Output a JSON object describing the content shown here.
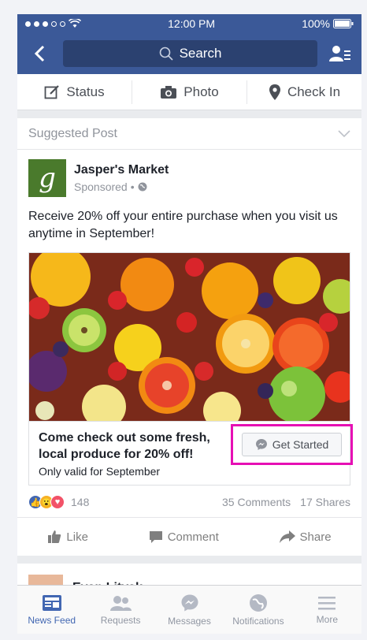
{
  "status_bar": {
    "time": "12:00 PM",
    "battery": "100%"
  },
  "nav": {
    "search_label": "Search"
  },
  "composer": [
    {
      "label": "Status",
      "icon": "edit-icon"
    },
    {
      "label": "Photo",
      "icon": "camera-icon"
    },
    {
      "label": "Check In",
      "icon": "location-pin-icon"
    }
  ],
  "post": {
    "header_label": "Suggested Post",
    "page_name": "Jasper's Market",
    "logo_letter": "g",
    "sponsored": "Sponsored",
    "message": "Receive 20% off your entire purchase when you visit us anytime in September!",
    "cta_headline": "Come check out some fresh, local produce for 20% off!",
    "cta_sub": "Only valid for September",
    "cta_button": "Get Started",
    "reaction_count": "148",
    "comments": "35 Comments",
    "shares": "17 Shares",
    "actions": {
      "like": "Like",
      "comment": "Comment",
      "share": "Share"
    }
  },
  "next_post": {
    "author_partial": "Evan Litvak"
  },
  "tabbar": [
    {
      "label": "News Feed",
      "icon": "news-feed-icon",
      "active": true
    },
    {
      "label": "Requests",
      "icon": "friend-requests-icon",
      "active": false
    },
    {
      "label": "Messages",
      "icon": "messenger-icon",
      "active": false
    },
    {
      "label": "Notifications",
      "icon": "globe-icon",
      "active": false
    },
    {
      "label": "More",
      "icon": "menu-icon",
      "active": false
    }
  ],
  "colors": {
    "brand": "#3b5998",
    "highlight": "#e60fb4",
    "active_tab": "#4267b2"
  }
}
